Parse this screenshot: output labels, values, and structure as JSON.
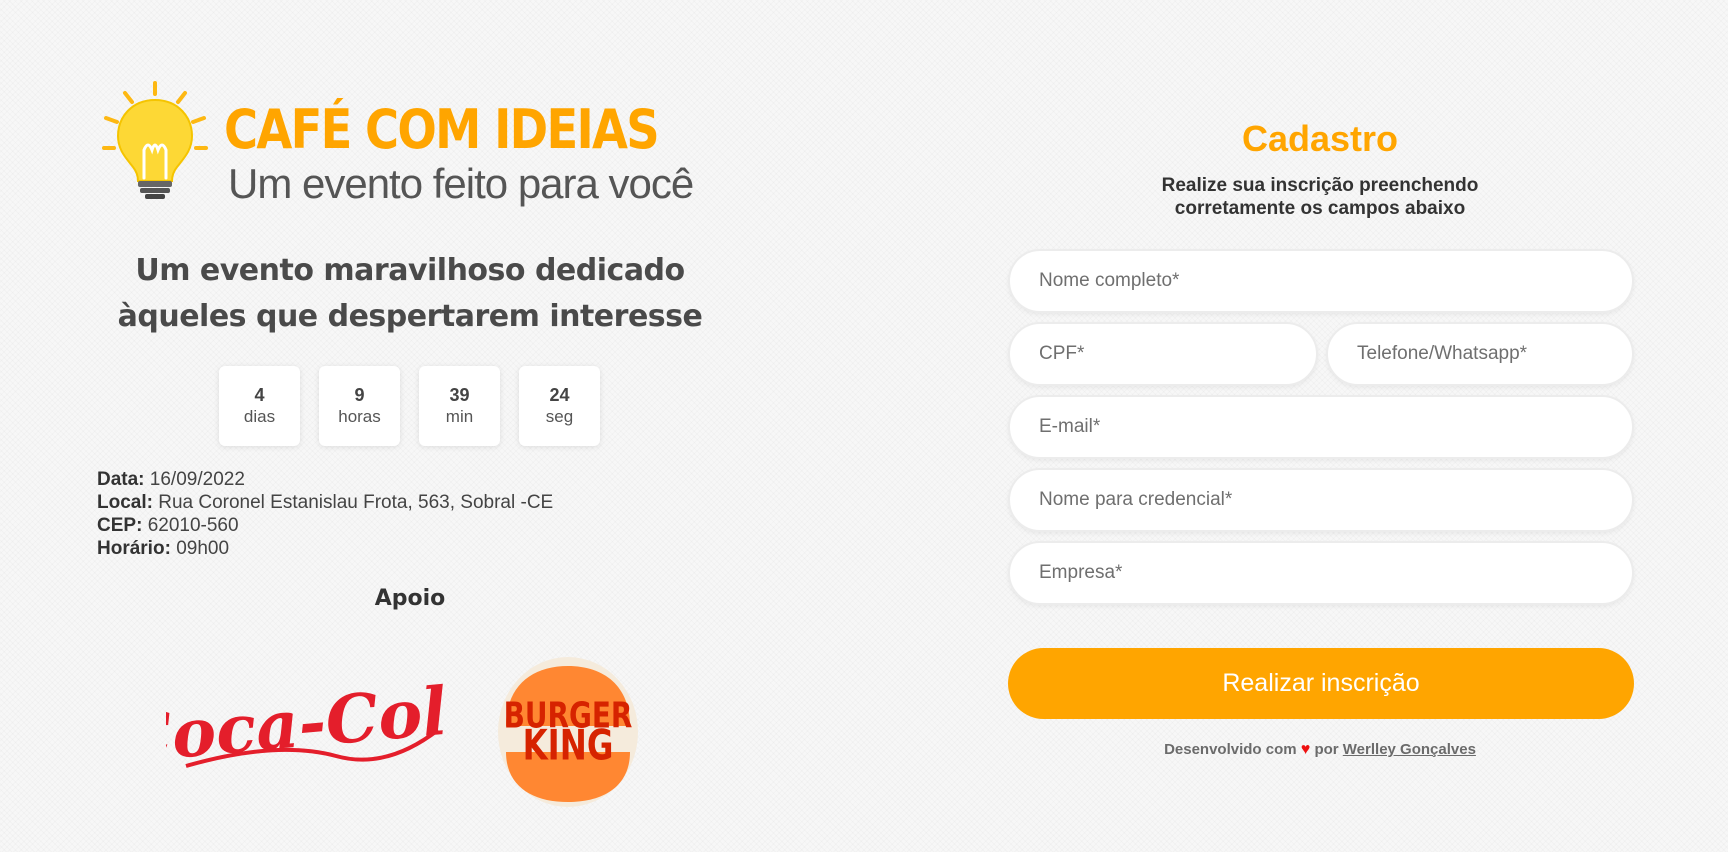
{
  "event": {
    "logo_title": "CAFÉ COM IDEIAS",
    "logo_tagline": "Um evento feito para você",
    "headline": "Um evento maravilhoso dedicado àqueles que despertarem interesse"
  },
  "countdown": [
    {
      "value": "4",
      "unit": "dias"
    },
    {
      "value": "9",
      "unit": "horas"
    },
    {
      "value": "39",
      "unit": "min"
    },
    {
      "value": "24",
      "unit": "seg"
    }
  ],
  "details": [
    {
      "label": "Data:",
      "value": "16/09/2022"
    },
    {
      "label": "Local:",
      "value": "Rua Coronel Estanislau Frota, 563, Sobral -CE"
    },
    {
      "label": "CEP:",
      "value": "62010-560"
    },
    {
      "label": "Horário:",
      "value": "09h00"
    }
  ],
  "sponsors": {
    "title": "Apoio",
    "items": [
      {
        "name": "Coca-Cola",
        "logo_text": "Coca-Cola"
      },
      {
        "name": "Burger King",
        "logo_text_top": "BURGER",
        "logo_text_bottom": "KING"
      }
    ]
  },
  "form": {
    "title": "Cadastro",
    "subtitle_line1": "Realize sua inscrição preenchendo",
    "subtitle_line2": "corretamente os campos abaixo",
    "fields": {
      "name": {
        "placeholder": "Nome completo*",
        "value": ""
      },
      "cpf": {
        "placeholder": "CPF*",
        "value": ""
      },
      "phone": {
        "placeholder": "Telefone/Whatsapp*",
        "value": ""
      },
      "email": {
        "placeholder": "E-mail*",
        "value": ""
      },
      "badge_name": {
        "placeholder": "Nome para credencial*",
        "value": ""
      },
      "company": {
        "placeholder": "Empresa*",
        "value": ""
      }
    },
    "submit_label": "Realizar inscrição"
  },
  "footer": {
    "prefix": "Desenvolvido com",
    "heart": "♥",
    "middle": "por",
    "author": "Werlley Gonçalves"
  },
  "colors": {
    "accent": "#ffa500",
    "bulb": "#fdd835",
    "heart": "#e11111",
    "coke_red": "#e41e2b",
    "bk_orange": "#ff8732",
    "bk_red": "#d62300"
  },
  "icons": [
    "lightbulb-icon",
    "heart-icon",
    "coca-cola-logo",
    "burger-king-logo"
  ]
}
